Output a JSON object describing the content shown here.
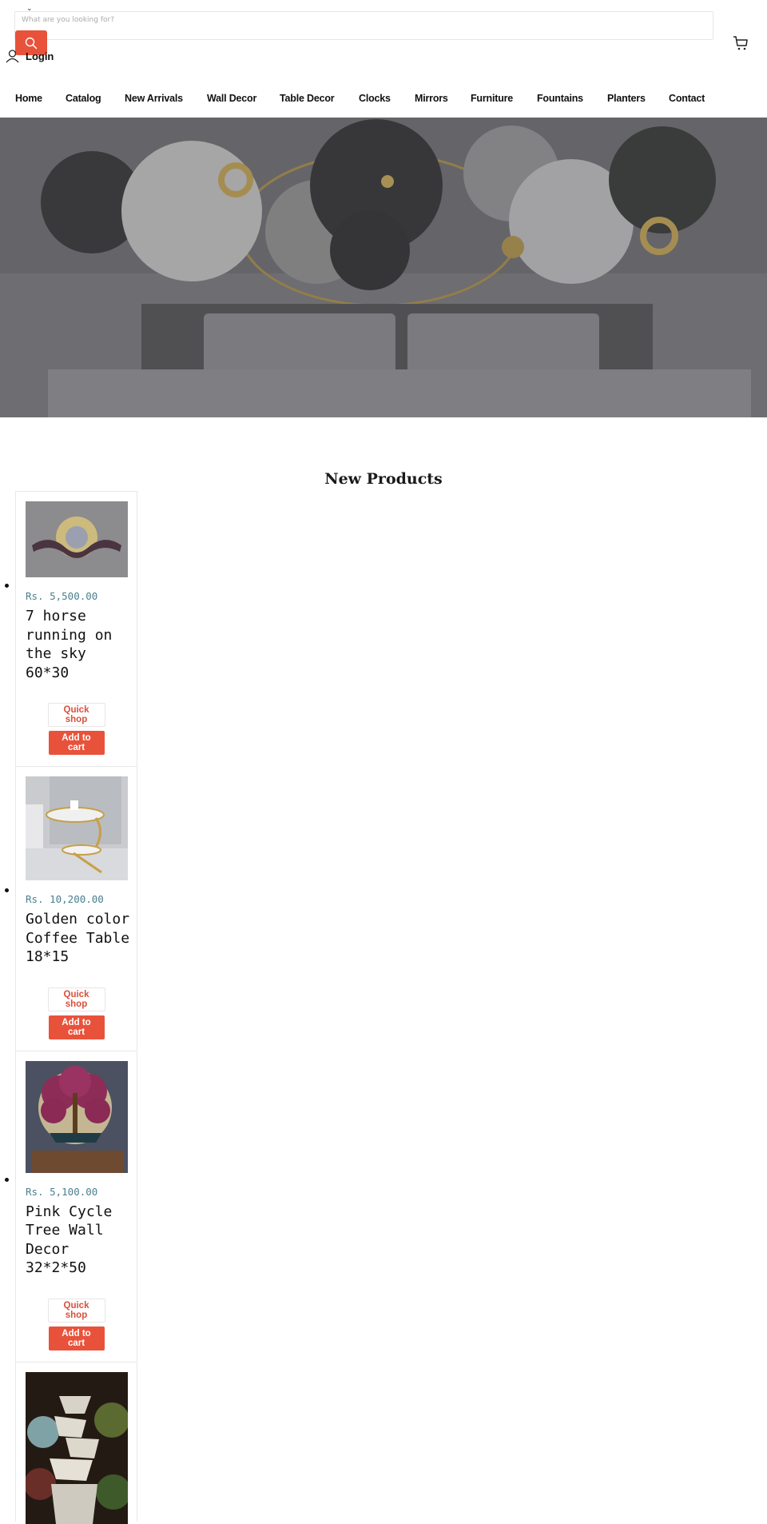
{
  "header": {
    "search": {
      "placeholder": "What are you looking for?",
      "value": ""
    },
    "search_icon": "search-icon",
    "login_label": "Login",
    "account_icon": "user-icon",
    "cart_icon": "cart-icon",
    "accent_color": "#e8523a"
  },
  "nav": {
    "items": [
      {
        "label": "Home"
      },
      {
        "label": "Catalog"
      },
      {
        "label": "New Arrivals"
      },
      {
        "label": "Wall Decor"
      },
      {
        "label": "Table Decor"
      },
      {
        "label": "Clocks"
      },
      {
        "label": "Mirrors"
      },
      {
        "label": "Furniture"
      },
      {
        "label": "Fountains"
      },
      {
        "label": "Planters"
      },
      {
        "label": "Contact"
      }
    ]
  },
  "hero": {
    "image": "wall-decor-bedroom-banner"
  },
  "section": {
    "title": "New Products",
    "products": [
      {
        "image": "horse-sun-wall-decor",
        "price": "Rs. 5,500.00",
        "name": "7 horse running on the sky 60*30",
        "quick_shop": "Quick shop",
        "add_to_cart": "Add to cart"
      },
      {
        "image": "golden-coffee-table",
        "price": "Rs. 10,200.00",
        "name": "Golden color Coffee Table 18*15",
        "quick_shop": "Quick shop",
        "add_to_cart": "Add to cart"
      },
      {
        "image": "pink-tree-wall-decor",
        "price": "Rs. 5,100.00",
        "name": "Pink Cycle Tree Wall Decor 32*2*50",
        "quick_shop": "Quick shop",
        "add_to_cart": "Add to cart"
      },
      {
        "image": "stone-waterfall-fountain"
      }
    ],
    "price_color": "#4a7f8e"
  }
}
